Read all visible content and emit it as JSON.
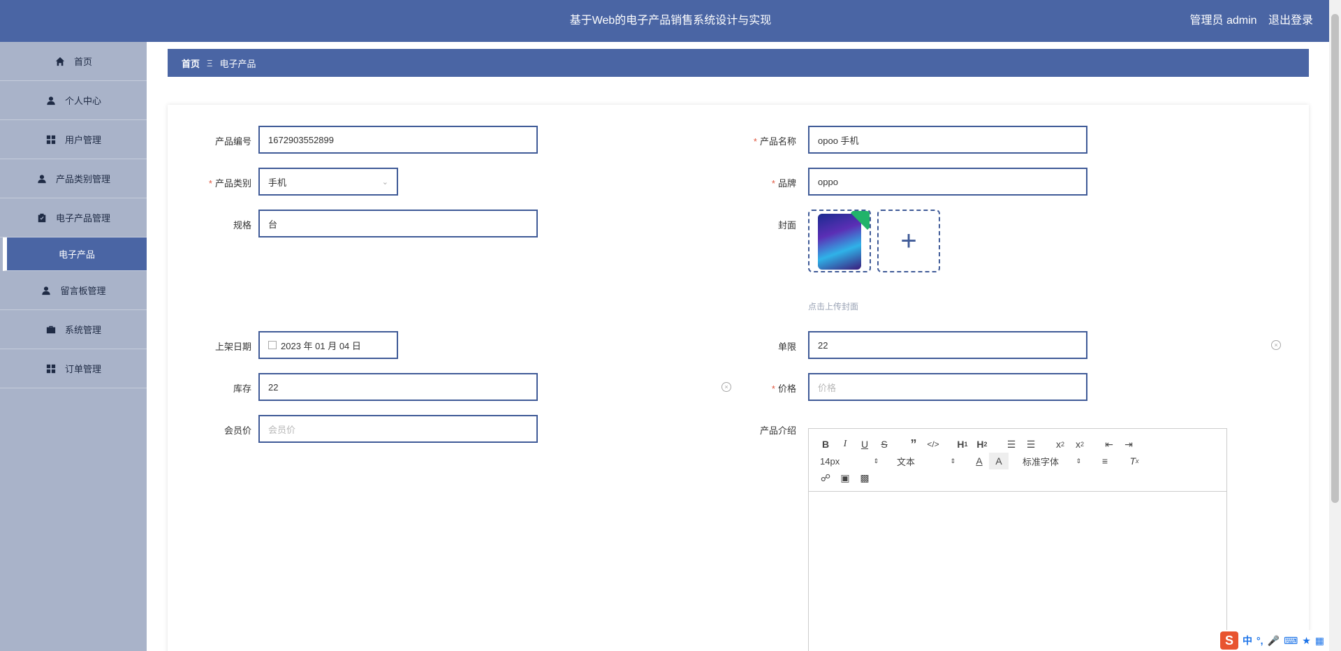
{
  "header": {
    "title": "基于Web的电子产品销售系统设计与实现",
    "user_label": "管理员 admin",
    "logout_label": "退出登录"
  },
  "sidebar": {
    "items": [
      {
        "label": "首页",
        "icon": "home-icon"
      },
      {
        "label": "个人中心",
        "icon": "user-icon"
      },
      {
        "label": "用户管理",
        "icon": "grid-icon"
      },
      {
        "label": "产品类别管理",
        "icon": "user-icon"
      },
      {
        "label": "电子产品管理",
        "icon": "clipboard-icon"
      },
      {
        "label": "电子产品",
        "icon": "",
        "active": true
      },
      {
        "label": "留言板管理",
        "icon": "user-icon"
      },
      {
        "label": "系统管理",
        "icon": "briefcase-icon"
      },
      {
        "label": "订单管理",
        "icon": "grid-icon"
      }
    ]
  },
  "breadcrumb": {
    "home": "首页",
    "separator": "Ξ",
    "current": "电子产品"
  },
  "form": {
    "product_no": {
      "label": "产品编号",
      "value": "1672903552899"
    },
    "product_name": {
      "label": "产品名称",
      "value": "opoo 手机",
      "required": true
    },
    "category": {
      "label": "产品类别",
      "value": "手机",
      "required": true
    },
    "brand": {
      "label": "品牌",
      "value": "oppo",
      "required": true
    },
    "spec": {
      "label": "规格",
      "value": "台"
    },
    "cover": {
      "label": "封面",
      "hint": "点击上传封面"
    },
    "date": {
      "label": "上架日期",
      "value": "2023 年 01 月 04 日"
    },
    "limit": {
      "label": "单限",
      "value": "22"
    },
    "stock": {
      "label": "库存",
      "value": "22"
    },
    "price": {
      "label": "价格",
      "placeholder": "价格",
      "required": true
    },
    "member_price": {
      "label": "会员价",
      "placeholder": "会员价"
    },
    "intro": {
      "label": "产品介绍"
    }
  },
  "editor": {
    "font_size": "14px",
    "block_type": "文本",
    "font_family": "标准字体"
  },
  "ime": {
    "lang": "中",
    "punct": "°,"
  },
  "colors": {
    "primary": "#4a65a4",
    "sidebar": "#a9b3c9",
    "required": "#e0563e"
  }
}
